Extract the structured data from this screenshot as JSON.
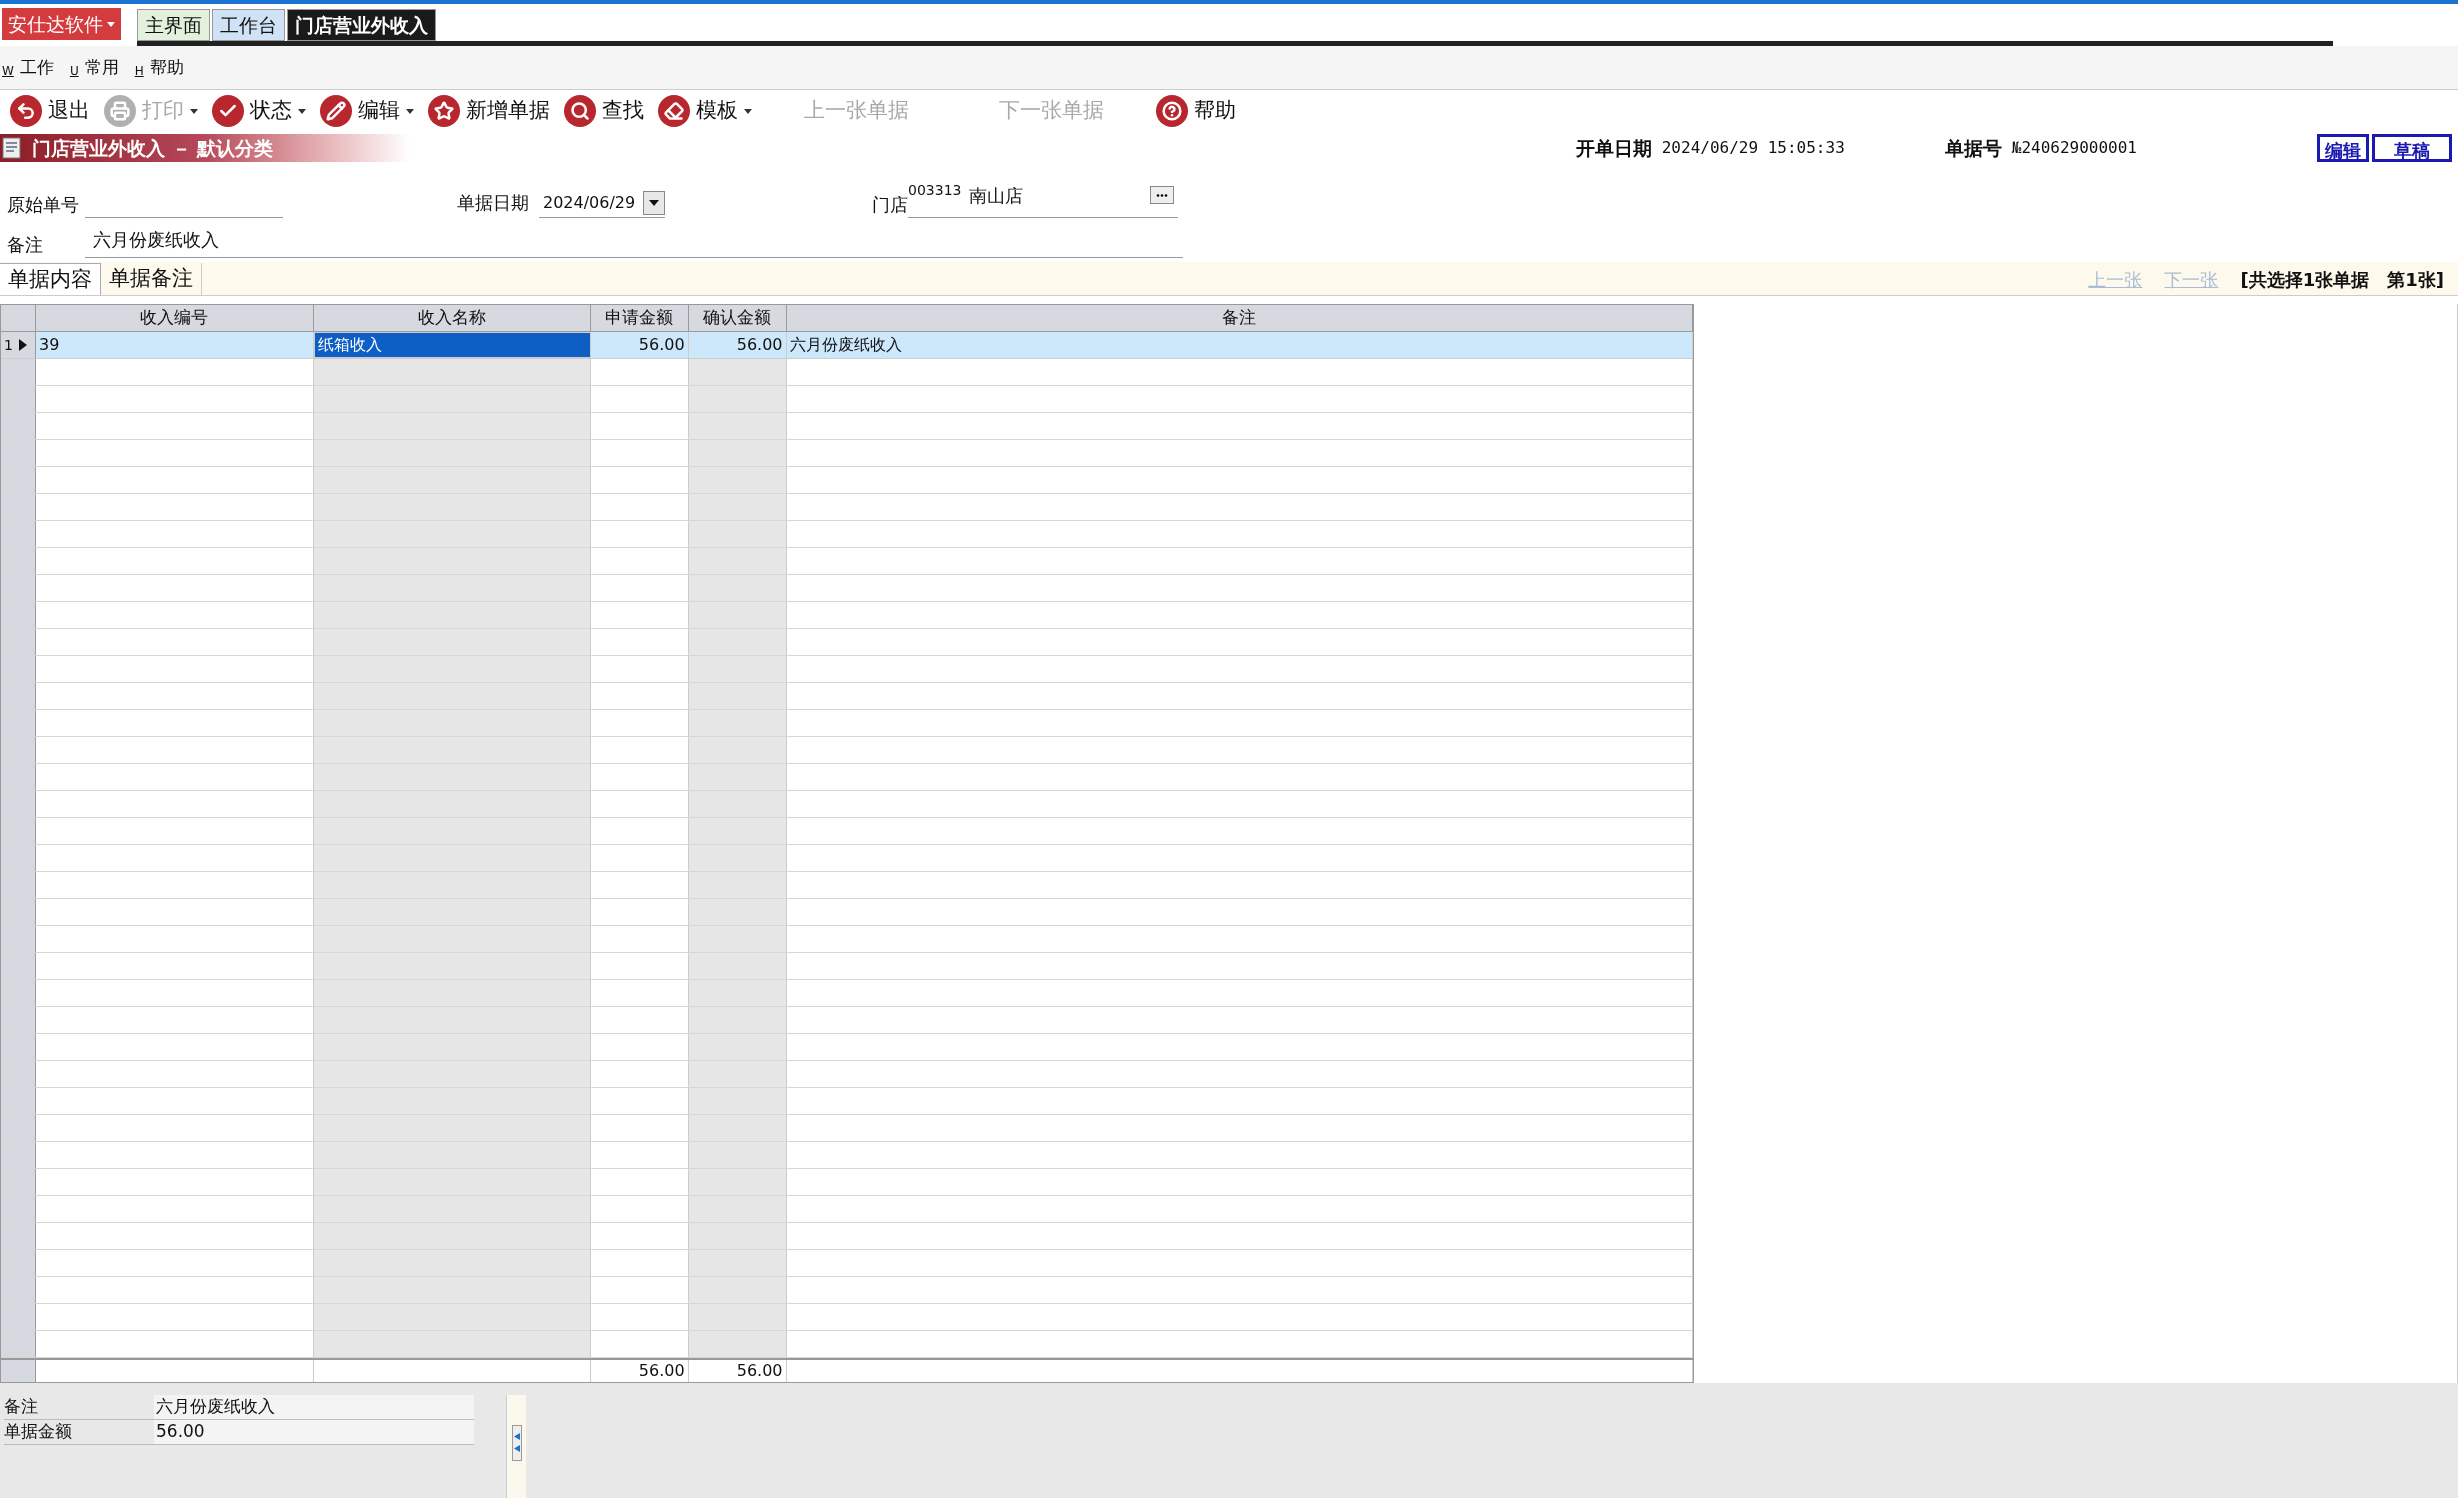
{
  "app_button": {
    "label": "安仕达软件"
  },
  "tabs": [
    {
      "label": "主界面",
      "selected": false
    },
    {
      "label": "工作台",
      "selected": false
    },
    {
      "label": "门店营业外收入",
      "selected": true
    }
  ],
  "menu": [
    {
      "key": "W",
      "label": "工作"
    },
    {
      "key": "U",
      "label": "常用"
    },
    {
      "key": "H",
      "label": "帮助"
    }
  ],
  "toolbar": [
    {
      "label": "退出",
      "disabled": false,
      "has_menu": false,
      "has_icon": true
    },
    {
      "label": "打印",
      "disabled": true,
      "has_menu": true,
      "has_icon": true
    },
    {
      "label": "状态",
      "disabled": false,
      "has_menu": true,
      "has_icon": true
    },
    {
      "label": "编辑",
      "disabled": false,
      "has_menu": true,
      "has_icon": true
    },
    {
      "label": "新增单据",
      "disabled": false,
      "has_menu": false,
      "has_icon": true
    },
    {
      "label": "查找",
      "disabled": false,
      "has_menu": false,
      "has_icon": true
    },
    {
      "label": "模板",
      "disabled": false,
      "has_menu": true,
      "has_icon": true
    },
    {
      "label": "上一张单据",
      "disabled": true,
      "has_menu": false,
      "has_icon": false
    },
    {
      "label": "下一张单据",
      "disabled": true,
      "has_menu": false,
      "has_icon": false
    },
    {
      "label": "帮助",
      "disabled": false,
      "has_menu": false,
      "has_icon": true
    }
  ],
  "document_title": "门店营业外收入 － 默认分类",
  "header_info": [
    {
      "label": "开单日期",
      "value": "2024/06/29 15:05:33"
    },
    {
      "label": "单据号",
      "value": "№240629000001"
    }
  ],
  "status_buttons": [
    "编辑",
    "草稿"
  ],
  "form": {
    "original_no": {
      "label": "原始单号"
    },
    "doc_date": {
      "label": "单据日期",
      "value": "2024/06/29"
    },
    "store": {
      "label": "门店",
      "code": "003313",
      "name": "南山店"
    },
    "remark": {
      "label": "备注",
      "value": "六月份废纸收入"
    }
  },
  "section_tabs": [
    {
      "label": "单据内容",
      "selected": true
    },
    {
      "label": "单据备注",
      "selected": false
    }
  ],
  "pager": {
    "prev": {
      "label": "上一张",
      "disabled": true
    },
    "next": {
      "label": "下一张",
      "disabled": true
    },
    "summary": "[共选择1张单据　第1张]"
  },
  "table": {
    "columns": [
      {
        "label": "收入编号",
        "readonly": false
      },
      {
        "label": "收入名称",
        "readonly": true
      },
      {
        "label": "申请金额",
        "readonly": false,
        "total": "56.00"
      },
      {
        "label": "确认金额",
        "readonly": true,
        "total": "56.00"
      },
      {
        "label": "备注",
        "readonly": false
      }
    ],
    "rows": [
      {
        "number": "1",
        "selected": true,
        "cells": [
          {
            "text": "39",
            "focused": false
          },
          {
            "text": "纸箱收入",
            "focused": true
          },
          {
            "text": "56.00",
            "focused": false
          },
          {
            "text": "56.00",
            "focused": false
          },
          {
            "text": "六月份废纸收入",
            "focused": false
          }
        ]
      }
    ],
    "has_totals_row": true
  },
  "properties": [
    {
      "label": "备注",
      "value": "六月份废纸收入"
    },
    {
      "label": "单据金额",
      "value": "56.00"
    }
  ]
}
